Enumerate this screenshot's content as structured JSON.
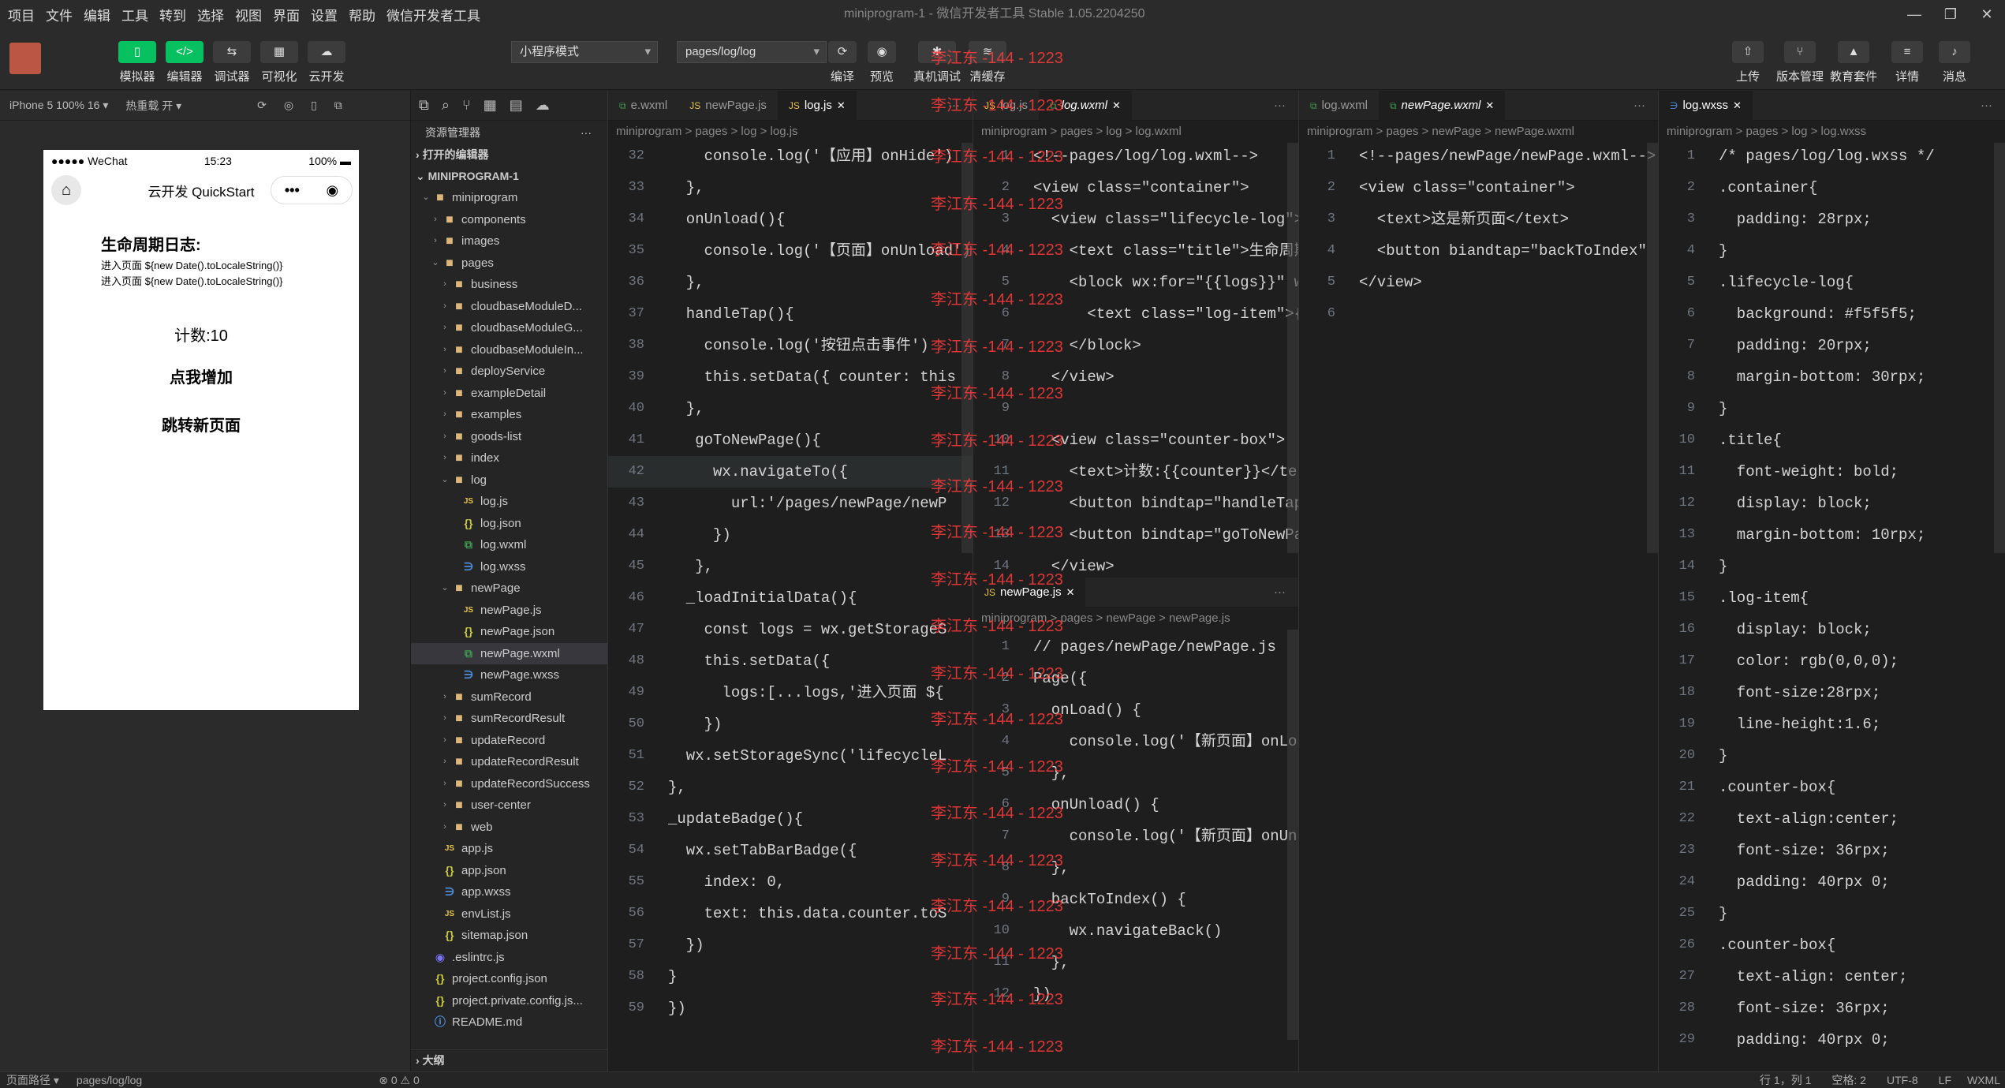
{
  "menu": [
    "项目",
    "文件",
    "编辑",
    "工具",
    "转到",
    "选择",
    "视图",
    "界面",
    "设置",
    "帮助",
    "微信开发者工具"
  ],
  "window_title": "miniprogram-1 - 微信开发者工具 Stable 1.05.2204250",
  "toolbar": {
    "simulator": "模拟器",
    "editor": "编辑器",
    "debugger": "调试器",
    "visual": "可视化",
    "cloud": "云开发",
    "mode": "小程序模式",
    "path": "pages/log/log",
    "compile": "编译",
    "preview": "预览",
    "realdebug": "真机调试",
    "clearcache": "清缓存",
    "upload": "上传",
    "version": "版本管理",
    "edu": "教育套件",
    "detail": "详情",
    "message": "消息"
  },
  "sim_header": {
    "device": "iPhone 5 100% 16 ▾",
    "hotreload": "热重载 开 ▾"
  },
  "phone": {
    "signal": "●●●●● WeChat",
    "time": "15:23",
    "battery": "100%",
    "title": "云开发 QuickStart",
    "heading": "生命周期日志:",
    "logs": [
      "进入页面 ${new Date().toLocaleString()}",
      "进入页面 ${new Date().toLocaleString()}"
    ],
    "counter": "计数:10",
    "btn_add": "点我增加",
    "btn_nav": "跳转新页面"
  },
  "explorer": {
    "title": "资源管理器",
    "open_editors": "打开的编辑器",
    "project": "MINIPROGRAM-1",
    "outline": "大纲",
    "tree": [
      {
        "d": 1,
        "n": "miniprogram",
        "t": "folder",
        "o": true
      },
      {
        "d": 2,
        "n": "components",
        "t": "folder"
      },
      {
        "d": 2,
        "n": "images",
        "t": "folder"
      },
      {
        "d": 2,
        "n": "pages",
        "t": "folder",
        "o": true
      },
      {
        "d": 3,
        "n": "business",
        "t": "folder"
      },
      {
        "d": 3,
        "n": "cloudbaseModuleD...",
        "t": "folder"
      },
      {
        "d": 3,
        "n": "cloudbaseModuleG...",
        "t": "folder"
      },
      {
        "d": 3,
        "n": "cloudbaseModuleIn...",
        "t": "folder"
      },
      {
        "d": 3,
        "n": "deployService",
        "t": "folder"
      },
      {
        "d": 3,
        "n": "exampleDetail",
        "t": "folder"
      },
      {
        "d": 3,
        "n": "examples",
        "t": "folder"
      },
      {
        "d": 3,
        "n": "goods-list",
        "t": "folder"
      },
      {
        "d": 3,
        "n": "index",
        "t": "folder"
      },
      {
        "d": 3,
        "n": "log",
        "t": "folder",
        "o": true
      },
      {
        "d": 4,
        "n": "log.js",
        "t": "js"
      },
      {
        "d": 4,
        "n": "log.json",
        "t": "json"
      },
      {
        "d": 4,
        "n": "log.wxml",
        "t": "wxml"
      },
      {
        "d": 4,
        "n": "log.wxss",
        "t": "wxss"
      },
      {
        "d": 3,
        "n": "newPage",
        "t": "folder",
        "o": true
      },
      {
        "d": 4,
        "n": "newPage.js",
        "t": "js"
      },
      {
        "d": 4,
        "n": "newPage.json",
        "t": "json"
      },
      {
        "d": 4,
        "n": "newPage.wxml",
        "t": "wxml",
        "s": true
      },
      {
        "d": 4,
        "n": "newPage.wxss",
        "t": "wxss"
      },
      {
        "d": 3,
        "n": "sumRecord",
        "t": "folder"
      },
      {
        "d": 3,
        "n": "sumRecordResult",
        "t": "folder"
      },
      {
        "d": 3,
        "n": "updateRecord",
        "t": "folder"
      },
      {
        "d": 3,
        "n": "updateRecordResult",
        "t": "folder"
      },
      {
        "d": 3,
        "n": "updateRecordSuccess",
        "t": "folder"
      },
      {
        "d": 3,
        "n": "user-center",
        "t": "folder"
      },
      {
        "d": 3,
        "n": "web",
        "t": "folder"
      },
      {
        "d": 2,
        "n": "app.js",
        "t": "js"
      },
      {
        "d": 2,
        "n": "app.json",
        "t": "json"
      },
      {
        "d": 2,
        "n": "app.wxss",
        "t": "wxss"
      },
      {
        "d": 2,
        "n": "envList.js",
        "t": "js"
      },
      {
        "d": 2,
        "n": "sitemap.json",
        "t": "json"
      },
      {
        "d": 1,
        "n": ".eslintrc.js",
        "t": "eslint"
      },
      {
        "d": 1,
        "n": "project.config.json",
        "t": "json"
      },
      {
        "d": 1,
        "n": "project.private.config.js...",
        "t": "json"
      },
      {
        "d": 1,
        "n": "README.md",
        "t": "info"
      }
    ]
  },
  "editors": [
    {
      "tabs": [
        "e.wxml",
        "newPage.js",
        "log.js"
      ],
      "active": 2,
      "bc": "miniprogram > pages > log > log.js",
      "first": 32,
      "lines": [
        "    console.log('【应用】onHide')",
        "  },",
        "  onUnload(){",
        "    console.log('【页面】onUnload')",
        "  },",
        "  handleTap(){",
        "    console.log('按钮点击事件')",
        "    this.setData({ counter: this",
        "  },",
        "   goToNewPage(){",
        "     wx.navigateTo({",
        "       url:'/pages/newPage/newP",
        "     })",
        "   },",
        "  _loadInitialData(){",
        "    const logs = wx.getStorageS",
        "    this.setData({",
        "      logs:[...logs,'进入页面 ${",
        "    })",
        "  wx.setStorageSync('lifecycleL",
        "},",
        "_updateBadge(){",
        "  wx.setTabBarBadge({",
        "    index: 0,",
        "    text: this.data.counter.toS",
        "  })",
        "}",
        "})"
      ]
    },
    {
      "tabs": [
        "log.js",
        "log.wxml"
      ],
      "active": 1,
      "bc": "miniprogram > pages > log > log.wxml",
      "first": 1,
      "lines": [
        "<!--pages/log/log.wxml-->",
        "<view class=\"container\">",
        "  <view class=\"lifecycle-log\">",
        "    <text class=\"title\">生命周期日",
        "    <block wx:for=\"{{logs}}\" wx:k",
        "      <text class=\"log-item\">{{ite",
        "    </block>",
        "  </view>",
        "",
        "  <view class=\"counter-box\">",
        "    <text>计数:{{counter}}</text>",
        "    <button bindtap=\"handleTap\">点",
        "    <button bindtap=\"goToNewPage\"",
        "  </view>"
      ]
    },
    {
      "tabs": [
        "newPage.js"
      ],
      "active": 0,
      "bc": "miniprogram > pages > newPage > newPage.js",
      "first": 1,
      "lines": [
        "// pages/newPage/newPage.js",
        "Page({",
        "  onLoad() {",
        "    console.log('【新页面】onLoa",
        "  },",
        "  onUnload() {",
        "    console.log('【新页面】onUnl",
        "  },",
        "  backToIndex() {",
        "    wx.navigateBack()",
        "  },",
        "})"
      ]
    },
    {
      "tabs": [
        "log.wxml",
        "newPage.wxml"
      ],
      "active": 1,
      "bc": "miniprogram > pages > newPage > newPage.wxml",
      "first": 1,
      "lines": [
        "<!--pages/newPage/newPage.wxml-->",
        "<view class=\"container\">",
        "  <text>这是新页面</text>",
        "  <button biandtap=\"backToIndex\"",
        "</view>",
        ""
      ]
    },
    {
      "tabs": [
        "log.wxss"
      ],
      "active": 0,
      "bc": "miniprogram > pages > log > log.wxss",
      "first": 1,
      "lines": [
        "/* pages/log/log.wxss */",
        ".container{",
        "  padding: 28rpx;",
        "}",
        ".lifecycle-log{",
        "  background: #f5f5f5;",
        "  padding: 20rpx;",
        "  margin-bottom: 30rpx;",
        "}",
        ".title{",
        "  font-weight: bold;",
        "  display: block;",
        "  margin-bottom: 10rpx;",
        "}",
        ".log-item{",
        "  display: block;",
        "  color: rgb(0,0,0);",
        "  font-size:28rpx;",
        "  line-height:1.6;",
        "}",
        ".counter-box{",
        "  text-align:center;",
        "  font-size: 36rpx;",
        "  padding: 40rpx 0;",
        "}",
        ".counter-box{",
        "  text-align: center;",
        "  font-size: 36rpx;",
        "  padding: 40rpx 0;"
      ]
    }
  ],
  "watermark": "李江东 -144 - 1223",
  "status": {
    "pagepath": "页面路径 ▾",
    "path": "pages/log/log",
    "errors": "⊗ 0 ⚠ 0",
    "pos": "行 1，列 1",
    "space": "空格: 2",
    "enc": "UTF-8",
    "eol": "LF",
    "lang": "WXML"
  },
  "colors": {
    "accent": "#07c160",
    "bg": "#1e1e1e"
  }
}
